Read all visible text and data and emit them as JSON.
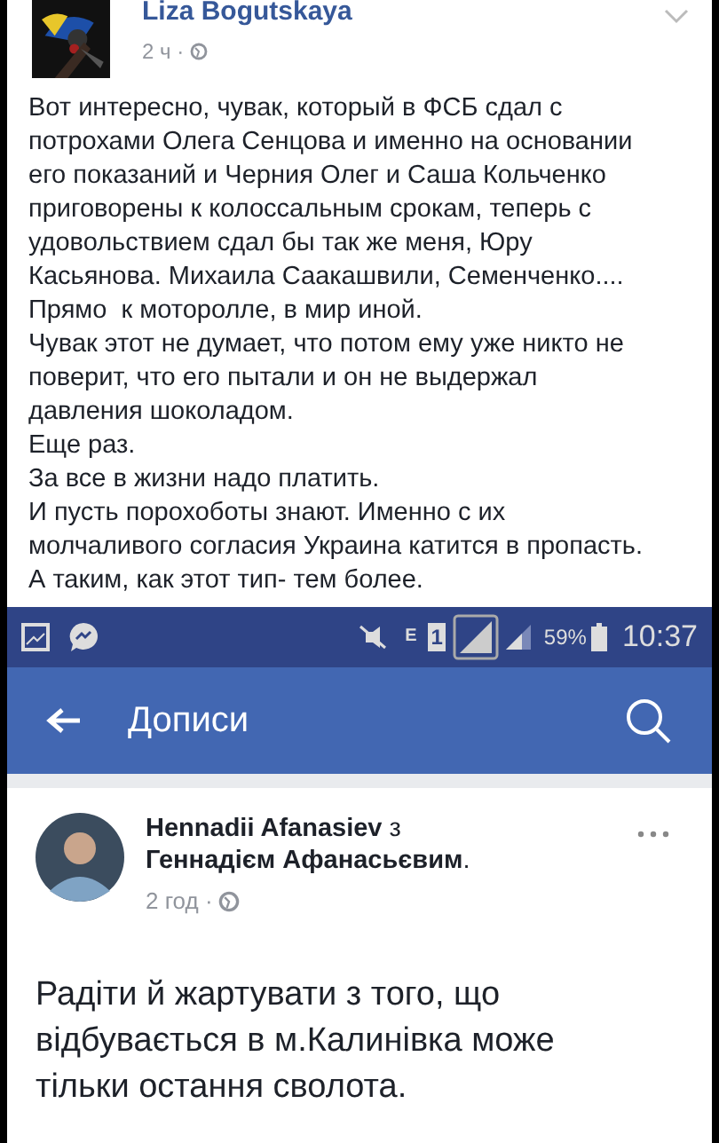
{
  "post_top": {
    "author": "Liza Bogutskaya",
    "time": "2 ч · ",
    "lines": [
      "Вот интересно, чувак, который в ФСБ сдал с",
      "потрохами Олега Сенцова и именно на основании",
      "его показаний и Черния Олег и Саша Кольченко",
      "приговорены к колоссальным срокам, теперь с",
      "удовольствием сдал бы так же меня, Юру",
      "Касьянова. Михаила Саакашвили, Семенченко....",
      "Прямо  к моторолле, в мир иной.",
      "Чувак этот не думает, что потом ему уже никто не",
      "поверит, что его пытали и он не выдержал",
      "давления шоколадом.",
      "Еще раз.",
      "За все в жизни надо платить.",
      "И пусть порохоботы знают. Именно с их",
      "молчаливого согласия Украина катится в пропасть.",
      "А таким, как этот тип- тем более."
    ]
  },
  "status_bar": {
    "network_type": "E",
    "sim": "1",
    "battery": "59%",
    "time": "10:37"
  },
  "app_bar": {
    "title": "Дописи"
  },
  "post_bottom": {
    "author": "**Hennadii Afanasiev** з **Геннадієм Афанасьєвим**.",
    "time": "2 год · ",
    "lines": [
      "Радіти й жартувати з того, що",
      "відбувається в м.Калинівка може",
      "тільки остання сволота."
    ]
  }
}
